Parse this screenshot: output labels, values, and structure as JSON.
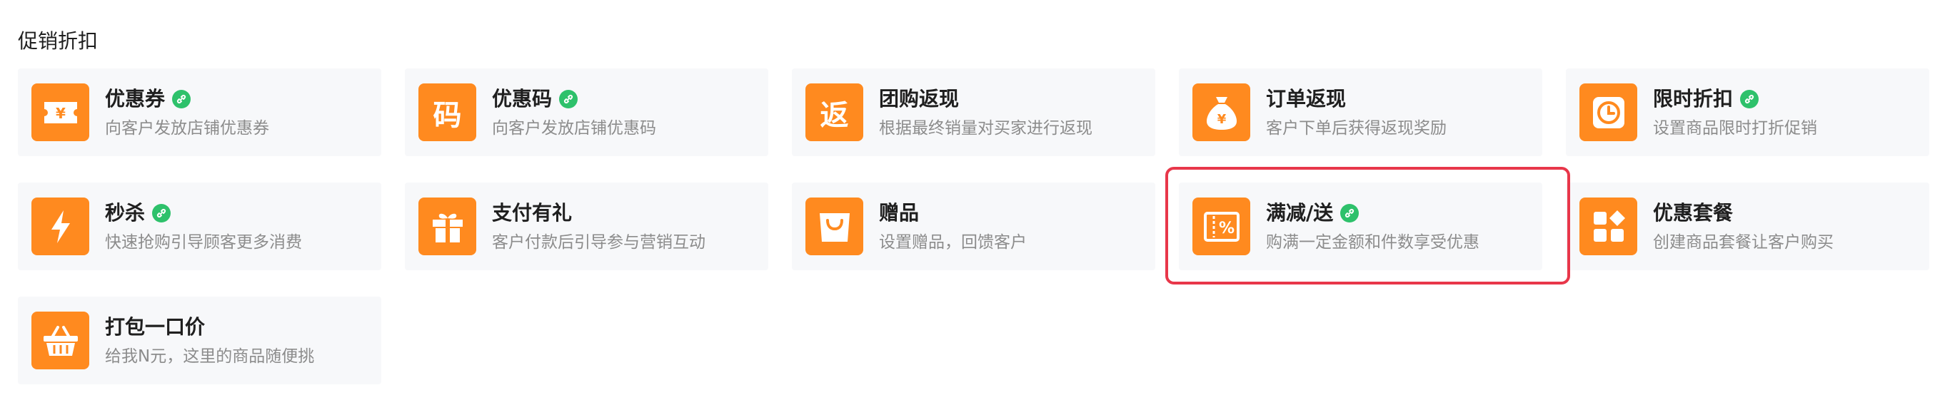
{
  "section": {
    "title": "促销折扣"
  },
  "colors": {
    "icon_bg": "#ff8a1f",
    "card_bg": "#f7f8fa",
    "badge": "#2ec16b",
    "highlight": "#e8374a"
  },
  "items": [
    {
      "title": "优惠券",
      "desc": "向客户发放店铺优惠券",
      "icon": "coupon-icon",
      "linked": true
    },
    {
      "title": "优惠码",
      "desc": "向客户发放店铺优惠码",
      "icon": "code-icon",
      "icon_char": "码",
      "linked": true
    },
    {
      "title": "团购返现",
      "desc": "根据最终销量对买家进行返现",
      "icon": "return-icon",
      "icon_char": "返",
      "linked": false
    },
    {
      "title": "订单返现",
      "desc": "客户下单后获得返现奖励",
      "icon": "money-bag-icon",
      "linked": false
    },
    {
      "title": "限时折扣",
      "desc": "设置商品限时打折促销",
      "icon": "clock-icon",
      "linked": true
    },
    {
      "title": "秒杀",
      "desc": "快速抢购引导顾客更多消费",
      "icon": "lightning-icon",
      "linked": true
    },
    {
      "title": "支付有礼",
      "desc": "客户付款后引导参与营销互动",
      "icon": "gift-icon",
      "linked": false
    },
    {
      "title": "赠品",
      "desc": "设置赠品，回馈客户",
      "icon": "shopping-bag-icon",
      "linked": false
    },
    {
      "title": "满减/送",
      "desc": "购满一定金额和件数享受优惠",
      "icon": "percent-voucher-icon",
      "linked": true,
      "highlighted": true
    },
    {
      "title": "优惠套餐",
      "desc": "创建商品套餐让客户购买",
      "icon": "bundle-icon",
      "linked": false
    },
    {
      "title": "打包一口价",
      "desc": "给我N元，这里的商品随便挑",
      "icon": "basket-icon",
      "linked": false
    }
  ]
}
